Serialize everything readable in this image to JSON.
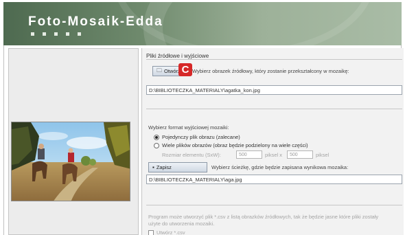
{
  "header": {
    "title": "Foto-Mosaik-Edda"
  },
  "section": {
    "title": "Pliki źródłowe i wyjściowe"
  },
  "source": {
    "open_button": "Otwórz",
    "marker_letter": "C",
    "hint": "Wybierz obrazek źródłowy, który zostanie przekształcony w mozaikę:",
    "path": "D:\\BIBLIOTECZKA_MATERIALY\\agatka_kon.jpg"
  },
  "output": {
    "format_label": "Wybierz format wyjściowej mozaiki:",
    "option_single": "Pojedynczy plik obrazu (zalecane)",
    "option_multi": "Wiele plików obrazów (obraz będzie podzielony na wiele części)",
    "size_label": "Rozmiar elementu (SxW):",
    "width_value": "500",
    "x_label": "piksel x",
    "height_value": "500",
    "px_label": "piksel",
    "save_button": "Zapisz",
    "save_hint": "Wybierz ścieżkę, gdzie będzie zapisana wynikowa mozaika:",
    "save_path": "D:\\BIBLIOTECZKA_MATERIALY\\aga.jpg"
  },
  "info": {
    "line1": "Program może utworzyć plik *.csv z listą obrazków źródłowych, tak że będzie jasne które pliki zostały",
    "line2": "użyte do utworzenia mozaiki.",
    "checkbox_label": "Utwórz *.csv"
  },
  "colors": {
    "header_green": "#6f8a6d",
    "marker_red": "#d62828"
  }
}
